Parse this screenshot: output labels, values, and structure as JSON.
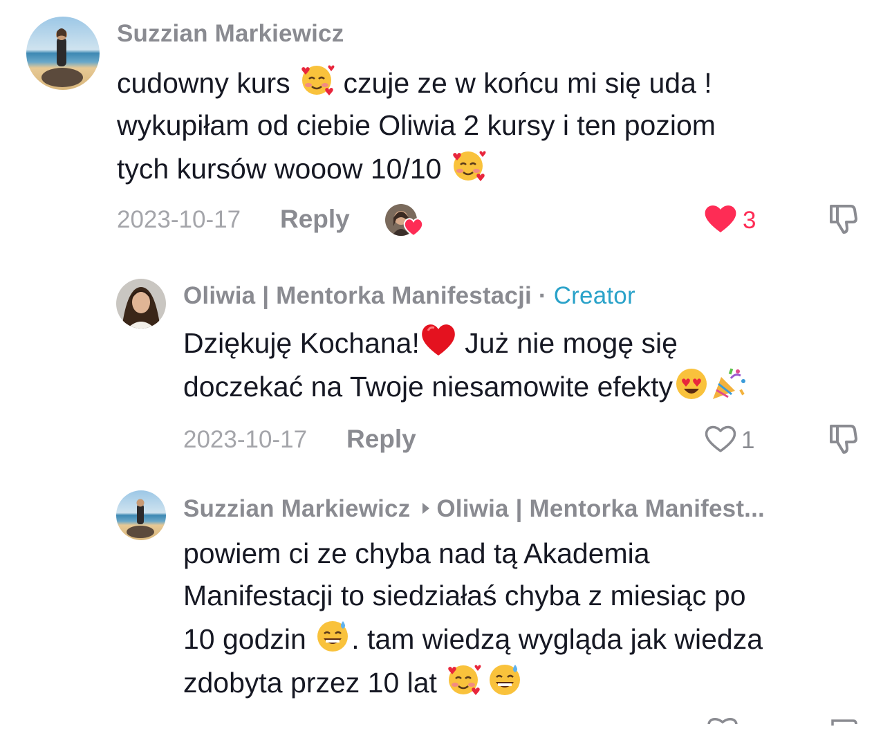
{
  "comments": [
    {
      "username": "Suzzian Markiewicz",
      "lines": [
        {
          "before": "cudowny kurs ",
          "emoji": "smiling-hearts",
          "after": " czuje ze w końcu mi się uda !"
        },
        {
          "text": "wykupiłam od ciebie Oliwia 2 kursy i ten poziom"
        },
        {
          "before": "tych kursów wooow 10/10 ",
          "emoji": "smiling-hearts",
          "after": ""
        }
      ],
      "date": "2023-10-17",
      "reply_label": "Reply",
      "likes": "3",
      "liked": true,
      "creator_liked": true
    },
    {
      "username": "Oliwia | Mentorka Manifestacji",
      "separator": " · ",
      "badge": "Creator",
      "line1_before": "Dziękuję Kochana!",
      "line1_after": " Już nie mogę się",
      "line2": "doczekać na Twoje niesamowite efekty",
      "date": "2023-10-17",
      "reply_label": "Reply",
      "likes": "1",
      "liked": false
    },
    {
      "username": "Suzzian Markiewicz",
      "reply_to": "Oliwia | Mentorka Manifest...",
      "line1": "powiem ci ze chyba nad tą Akademia",
      "line2": "Manifestacji to siedziałaś chyba z miesiąc po",
      "line3_before": "10 godzin ",
      "line3_after": ". tam wiedzą wygląda jak wiedza",
      "line4": "zdobyta przez 10 lat "
    }
  ],
  "colors": {
    "like_red": "#fe2c55",
    "creator_blue": "#2aa2c9",
    "muted_gray": "#8a8b91"
  },
  "icons": [
    "heart-filled-icon",
    "heart-outline-icon",
    "dislike-icon",
    "smiling-hearts-emoji",
    "red-heart-emoji",
    "heart-eyes-emoji",
    "party-popper-emoji",
    "sweat-smile-emoji"
  ]
}
